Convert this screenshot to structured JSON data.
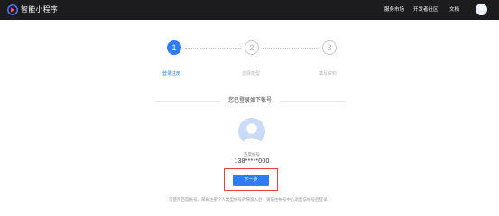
{
  "header": {
    "brand": "智能小程序",
    "nav": [
      "服务市场",
      "开发者社区",
      "文档"
    ],
    "accent": "#2f7df6",
    "bar_color": "#1c1c1f"
  },
  "steps": [
    {
      "number": "1",
      "label": "登录注册",
      "state": "active"
    },
    {
      "number": "2",
      "label": "选择类型",
      "state": "todo"
    },
    {
      "number": "3",
      "label": "填写资料",
      "state": "todo"
    }
  ],
  "account": {
    "section_title": "您已登录如下帐号",
    "label": "百度帐号",
    "number": "138*****000"
  },
  "actions": {
    "next_label": "下一步",
    "highlight_color": "#e04848"
  },
  "footnote": "可使用百度帐号、邮箱注册个人类型帐号的快速入驻，请前往帐号中心退出该帐号后登录。"
}
